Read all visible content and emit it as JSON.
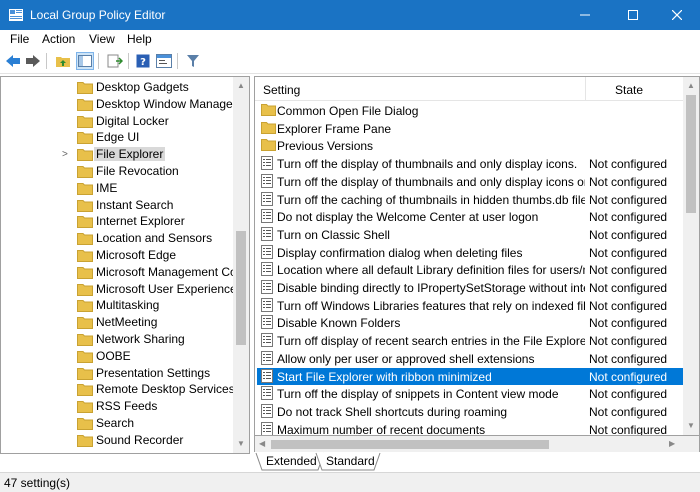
{
  "window": {
    "title": "Local Group Policy Editor"
  },
  "menu": [
    "File",
    "Action",
    "View",
    "Help"
  ],
  "toolbar": {
    "buttons": [
      "back-icon",
      "forward-icon",
      "up-folder-icon",
      "show-hide-tree-icon",
      "export-list-icon",
      "help-icon",
      "properties-icon",
      "filter-icon"
    ]
  },
  "tree": {
    "items": [
      {
        "label": "Desktop Gadgets"
      },
      {
        "label": "Desktop Window Manager"
      },
      {
        "label": "Digital Locker"
      },
      {
        "label": "Edge UI"
      },
      {
        "label": "File Explorer",
        "selected": true,
        "expandable": true
      },
      {
        "label": "File Revocation"
      },
      {
        "label": "IME"
      },
      {
        "label": "Instant Search"
      },
      {
        "label": "Internet Explorer"
      },
      {
        "label": "Location and Sensors"
      },
      {
        "label": "Microsoft Edge"
      },
      {
        "label": "Microsoft Management Con"
      },
      {
        "label": "Microsoft User Experience Vi"
      },
      {
        "label": "Multitasking"
      },
      {
        "label": "NetMeeting"
      },
      {
        "label": "Network Sharing"
      },
      {
        "label": "OOBE"
      },
      {
        "label": "Presentation Settings"
      },
      {
        "label": "Remote Desktop Services"
      },
      {
        "label": "RSS Feeds"
      },
      {
        "label": "Search"
      },
      {
        "label": "Sound Recorder"
      }
    ]
  },
  "list": {
    "columns": {
      "setting": "Setting",
      "state": "State"
    },
    "rows": [
      {
        "name": "Common Open File Dialog",
        "state": "",
        "type": "folder"
      },
      {
        "name": "Explorer Frame Pane",
        "state": "",
        "type": "folder"
      },
      {
        "name": "Previous Versions",
        "state": "",
        "type": "folder"
      },
      {
        "name": "Turn off the display of thumbnails and only display icons.",
        "state": "Not configured",
        "type": "setting"
      },
      {
        "name": "Turn off the display of thumbnails and only display icons on...",
        "state": "Not configured",
        "type": "setting"
      },
      {
        "name": "Turn off the caching of thumbnails in hidden thumbs.db files",
        "state": "Not configured",
        "type": "setting"
      },
      {
        "name": "Do not display the Welcome Center at user logon",
        "state": "Not configured",
        "type": "setting"
      },
      {
        "name": "Turn on Classic Shell",
        "state": "Not configured",
        "type": "setting"
      },
      {
        "name": "Display confirmation dialog when deleting files",
        "state": "Not configured",
        "type": "setting"
      },
      {
        "name": "Location where all default Library definition files for users/m...",
        "state": "Not configured",
        "type": "setting"
      },
      {
        "name": "Disable binding directly to IPropertySetStorage without inter...",
        "state": "Not configured",
        "type": "setting"
      },
      {
        "name": "Turn off Windows Libraries features that rely on indexed file ...",
        "state": "Not configured",
        "type": "setting"
      },
      {
        "name": "Disable Known Folders",
        "state": "Not configured",
        "type": "setting"
      },
      {
        "name": "Turn off display of recent search entries in the File Explorer s...",
        "state": "Not configured",
        "type": "setting"
      },
      {
        "name": "Allow only per user or approved shell extensions",
        "state": "Not configured",
        "type": "setting"
      },
      {
        "name": "Start File Explorer with ribbon minimized",
        "state": "Not configured",
        "type": "setting",
        "selected": true
      },
      {
        "name": "Turn off the display of snippets in Content view mode",
        "state": "Not configured",
        "type": "setting"
      },
      {
        "name": "Do not track Shell shortcuts during roaming",
        "state": "Not configured",
        "type": "setting"
      },
      {
        "name": "Maximum number of recent documents",
        "state": "Not configured",
        "type": "setting"
      }
    ]
  },
  "tabs": [
    "Extended",
    "Standard"
  ],
  "status": {
    "text": "47 setting(s)"
  },
  "colors": {
    "titlebar": "#1a73c4",
    "selection": "#0078d7",
    "folder": "#e8c04a"
  }
}
